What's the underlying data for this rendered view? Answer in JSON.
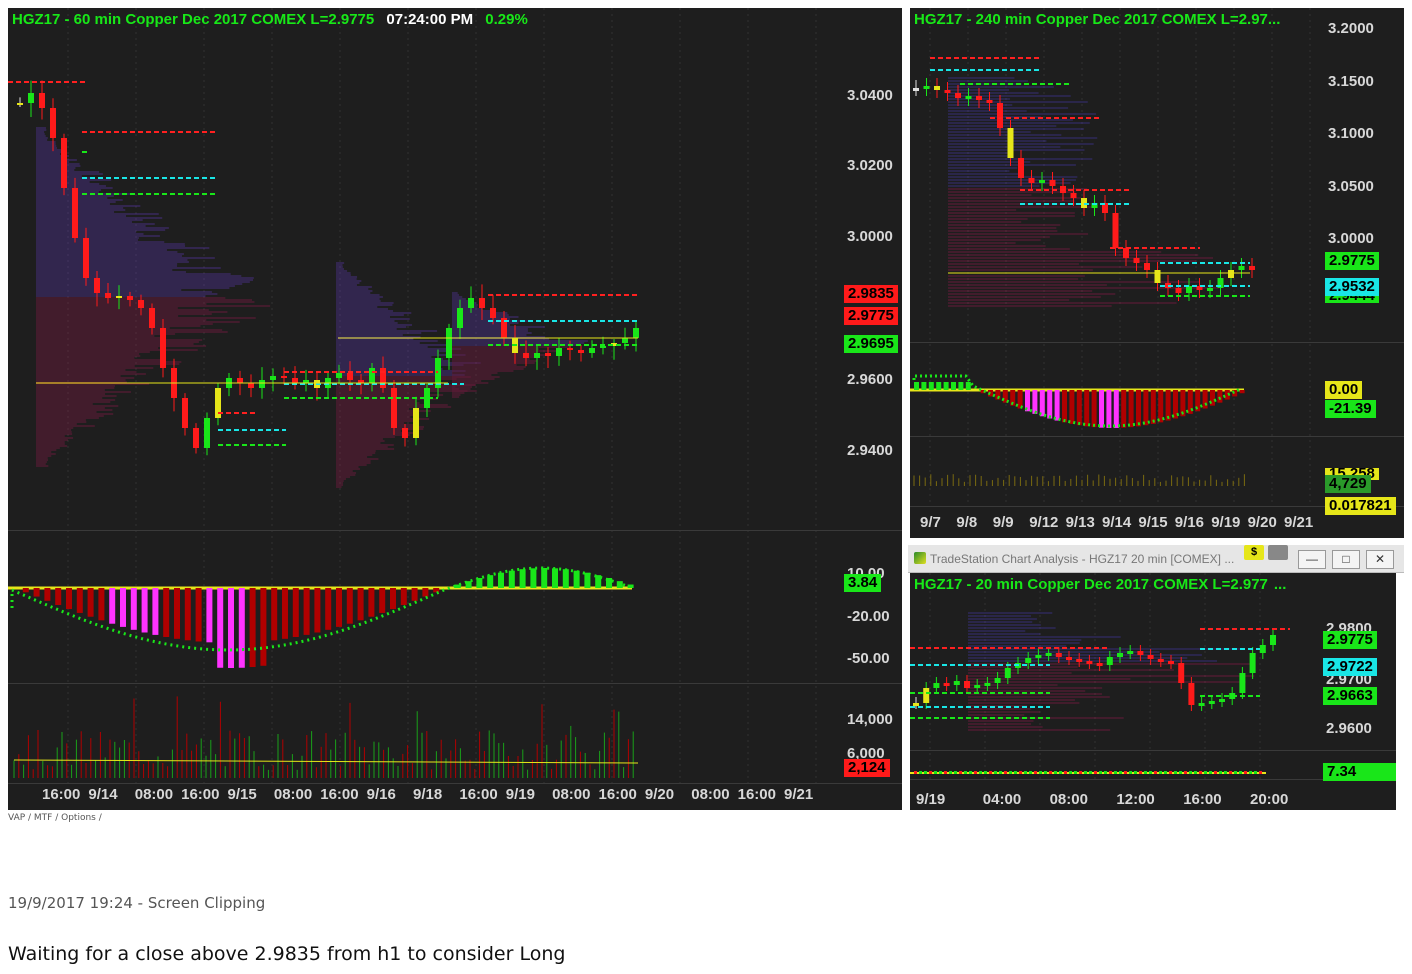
{
  "main_chart": {
    "title": "HGZ17 - 60 min  Copper Dec 2017  COMEX  L=2.9775",
    "time": "07:24:00 PM",
    "change": "0.29%",
    "price_labels": [
      "3.0400",
      "3.0200",
      "3.0000",
      "2.9600",
      "2.9400"
    ],
    "tags": [
      {
        "text": "2.9835",
        "color": "red"
      },
      {
        "text": "2.9775",
        "color": "red"
      },
      {
        "text": "2.9695",
        "color": "green"
      }
    ],
    "osc_labels": [
      "10.00",
      "-20.00",
      "-50.00"
    ],
    "osc_tag": "3.84",
    "vol_labels": [
      "14,000",
      "6,000"
    ],
    "vol_tag": "2,124",
    "x_labels": [
      "16:00",
      "9/14",
      "08:00",
      "16:00",
      "9/15",
      "08:00",
      "16:00",
      "9/16",
      "9/18",
      "16:00",
      "9/19",
      "08:00",
      "16:00",
      "9/20",
      "08:00",
      "16:00",
      "9/21"
    ]
  },
  "chart_240": {
    "title": "HGZ17 - 240 min  Copper Dec 2017  COMEX  L=2.97",
    "title_suffix": "...",
    "price_labels": [
      "3.2000",
      "3.1500",
      "3.1000",
      "3.0500",
      "3.0000"
    ],
    "tags": [
      {
        "text": "2.9775",
        "color": "green"
      },
      {
        "text": "2.9532",
        "color": "cyan"
      },
      {
        "text": "2.9444",
        "color": "green"
      }
    ],
    "osc_tags": [
      {
        "text": "0.00",
        "color": "yellow"
      },
      {
        "text": "-21.39",
        "color": "green"
      }
    ],
    "vol_tags": [
      {
        "text": "15,258",
        "color": "yellow"
      },
      {
        "text": "4,729",
        "color": "green"
      },
      {
        "text": "0.017821",
        "color": "yellow"
      }
    ],
    "x_labels": [
      "9/7",
      "9/8",
      "9/9",
      "9/12",
      "9/13",
      "9/14",
      "9/15",
      "9/16",
      "9/19",
      "9/20",
      "9/21"
    ]
  },
  "window_20": {
    "window_title": "TradeStation Chart Analysis - HGZ17 20 min [COMEX] ...",
    "button_s": "$",
    "title": "HGZ17 - 20 min  Copper Dec 2017  COMEX  L=2.977",
    "title_suffix": "...",
    "price_labels": [
      "2.9800",
      "2.9700",
      "2.9600"
    ],
    "tags": [
      {
        "text": "2.9775",
        "color": "green"
      },
      {
        "text": "2.9722",
        "color": "cyan"
      },
      {
        "text": "2.9663",
        "color": "green"
      }
    ],
    "osc_tag": "7.34",
    "x_labels": [
      "9/19",
      "04:00",
      "08:00",
      "12:00",
      "16:00",
      "20:00"
    ]
  },
  "footer": {
    "tabs": "VAP / MTF / Options /",
    "clip_caption": "19/9/2017 19:24 - Screen Clipping",
    "note": "Waiting for a close above 2.9835 from h1 to consider Long"
  },
  "colors": {
    "background": "#1e1e1e",
    "bull": "#19e619",
    "bear": "#ff1a1a",
    "neutral": "#e6e619",
    "profile": "#4040c0",
    "cyan": "#19e6e6"
  }
}
